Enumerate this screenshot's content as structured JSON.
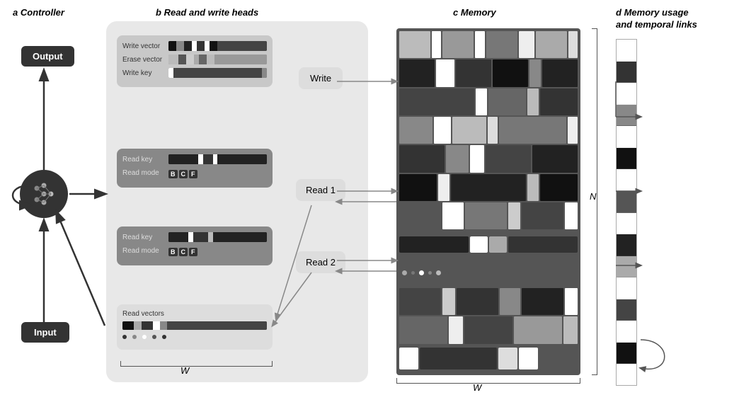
{
  "sections": {
    "a": {
      "label": "a",
      "title": "Controller"
    },
    "b": {
      "label": "b",
      "title": "Read and write heads"
    },
    "c": {
      "label": "c",
      "title": "Memory"
    },
    "d": {
      "label": "d",
      "title": "Memory usage",
      "subtitle": "and temporal links"
    }
  },
  "controller": {
    "output_label": "Output",
    "input_label": "Input"
  },
  "write_head": {
    "write_vector_label": "Write vector",
    "erase_vector_label": "Erase vector",
    "write_key_label": "Write key"
  },
  "read_head_1": {
    "read_key_label": "Read key",
    "read_mode_label": "Read mode",
    "modes": [
      "B",
      "C",
      "F"
    ]
  },
  "read_head_2": {
    "read_key_label": "Read key",
    "read_mode_label": "Read mode",
    "modes": [
      "B",
      "C",
      "F"
    ]
  },
  "read_vectors": {
    "label": "Read vectors"
  },
  "buttons": {
    "write": "Write",
    "read1": "Read 1",
    "read2": "Read 2"
  },
  "labels": {
    "W": "W",
    "N": "N"
  }
}
